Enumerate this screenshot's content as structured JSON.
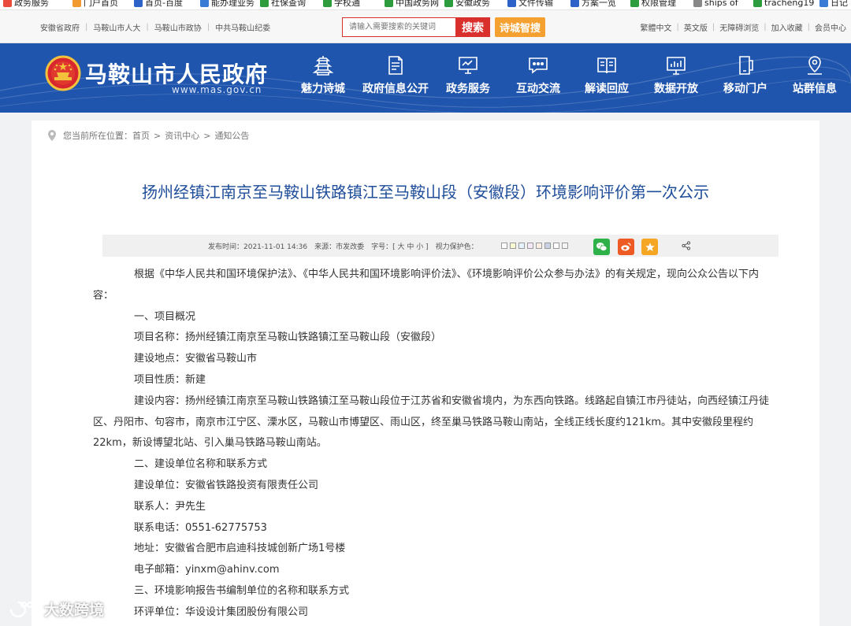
{
  "bookmarks": [
    "政务服务",
    "门户首页",
    "首页-百度",
    "能办理业务",
    "社保查询",
    "学校通",
    "中国政务网",
    "安徽政务",
    "文件传输",
    "方案一览",
    "权限管理",
    "ships of",
    "tracheng19",
    "日记"
  ],
  "top_links": [
    "安徽省政府",
    "马鞍山市人大",
    "马鞍山市政协",
    "中共马鞍山纪委"
  ],
  "search": {
    "placeholder": "请输入需要搜索的关键词",
    "button": "搜索"
  },
  "smart_search": "诗城智搜",
  "right_links": [
    "繁體中文",
    "英文版",
    "无障碍浏览",
    "加入收藏",
    "会员中心"
  ],
  "site": {
    "title": "马鞍山市人民政府",
    "domain": "www.mas.gov.cn"
  },
  "nav": [
    {
      "label": "魅力诗城",
      "icon": "pagoda-icon"
    },
    {
      "label": "政府信息公开",
      "icon": "document-icon"
    },
    {
      "label": "政务服务",
      "icon": "monitor-icon"
    },
    {
      "label": "互动交流",
      "icon": "chat-icon"
    },
    {
      "label": "解读回应",
      "icon": "book-icon"
    },
    {
      "label": "数据开放",
      "icon": "chart-icon"
    },
    {
      "label": "移动门户",
      "icon": "mobile-icon"
    },
    {
      "label": "站群信息",
      "icon": "location-icon"
    }
  ],
  "breadcrumb": {
    "prefix": "您当前所在位置：",
    "items": [
      "首页",
      "资讯中心",
      "通知公告"
    ],
    "separator": ">"
  },
  "article": {
    "title": "扬州经镇江南京至马鞍山铁路镇江至马鞍山段（安徽段）环境影响评价第一次公示",
    "meta": "发布时间：2021-11-01 14:36　来源：市发改委　字号：[ 大 中 小 ]　视力保护色：",
    "swatch_colors": [
      "#ffffff",
      "#fafad2",
      "#e6f4ff",
      "#f3e8f8",
      "#fbeee6",
      "#c8d3e6",
      "#ffffff",
      "#f4f4f4"
    ],
    "paragraphs": [
      "根据《中华人民共和国环境保护法》、《中华人民共和国环境影响评价法》、《环境影响评价公众参与办法》的有关规定，现向公众公告以下内容：",
      "一、项目概况",
      "项目名称：扬州经镇江南京至马鞍山铁路镇江至马鞍山段（安徽段）",
      "建设地点：安徽省马鞍山市",
      "项目性质：新建",
      "建设内容：扬州经镇江南京至马鞍山铁路镇江至马鞍山段位于江苏省和安徽省境内，为东西向铁路。线路起自镇江市丹徒站，向西经镇江丹徒区、丹阳市、句容市，南京市江宁区、溧水区，马鞍山市博望区、雨山区，终至巢马铁路马鞍山南站，全线正线长度约121km。其中安徽段里程约22km，新设博望北站、引入巢马铁路马鞍山南站。",
      "二、建设单位名称和联系方式",
      "建设单位：安徽省铁路投资有限责任公司",
      "联系人：尹先生",
      "联系电话：0551-62775753",
      "地址：安徽省合肥市启迪科技城创新广场1号楼",
      "电子邮箱：yinxm@ahinv.com",
      "三、环境影响报告书编制单位的名称和联系方式",
      "环评单位：华设设计集团股份有限公司"
    ]
  },
  "watermark": "大数跨境",
  "colors": {
    "header_blue": "#1f55ad",
    "title_blue": "#1e4d9a",
    "search_red": "#d9302e",
    "smart_orange": "#f4a131",
    "wechat_green": "#2fb14a",
    "weibo_orange": "#ee5a24",
    "fav_orange": "#f5a623"
  }
}
